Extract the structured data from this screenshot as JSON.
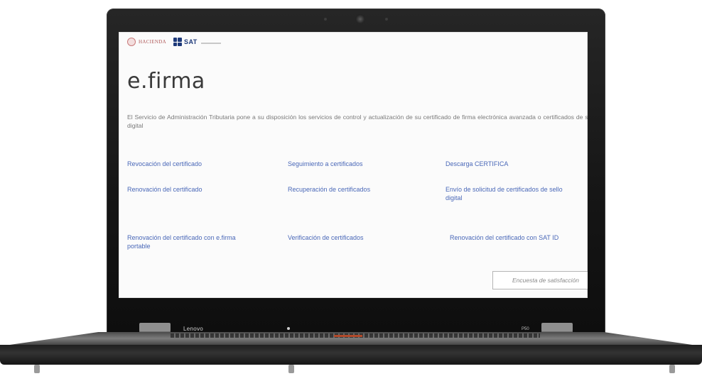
{
  "laptop": {
    "brand": "Lenovo",
    "model": "P50"
  },
  "header": {
    "hacienda_logo_text": "HACIENDA",
    "sat_logo_text": "SAT"
  },
  "page": {
    "title": "e.firma",
    "description": "El Servicio de Administración Tributaria pone a su disposición los servicios de control y actualización de su certificado de firma electrónica avanzada o certificados de sello digital"
  },
  "links": [
    "Revocación del certificado",
    "Seguimiento a certificados",
    "Descarga CERTIFICA",
    "Renovación del certificado",
    "Recuperación de certificados",
    "Envío de solicitud de certificados de sello digital",
    "Renovación del certificado con e.firma portable",
    "Verificación de certificados",
    "Renovación del certificado con SAT ID"
  ],
  "survey": {
    "label": "Encuesta de satisfacción"
  },
  "colors": {
    "link": "#4a68b8",
    "title": "#3a3a3a",
    "sat_blue": "#1e3a7a"
  }
}
